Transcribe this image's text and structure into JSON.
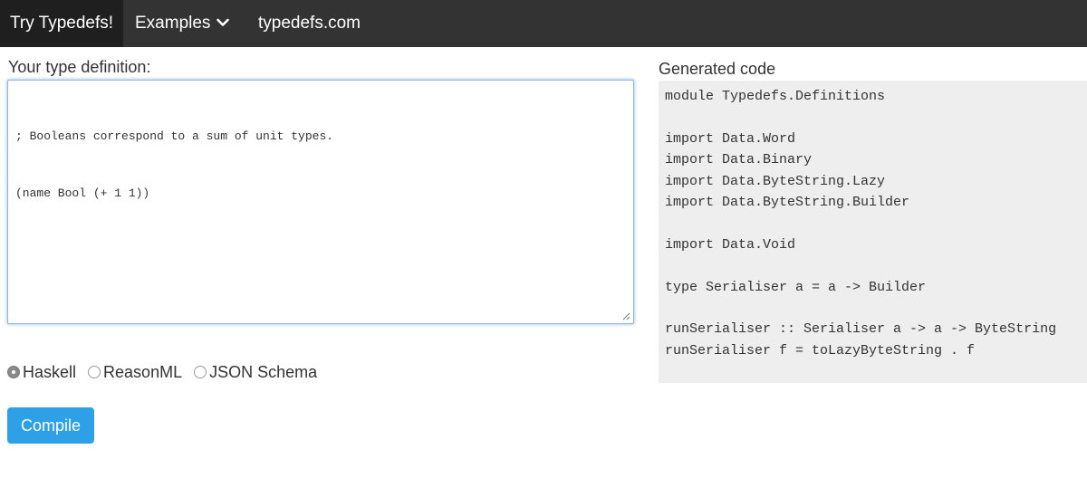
{
  "navbar": {
    "brand": "Try Typedefs!",
    "examples_label": "Examples",
    "site_link": "typedefs.com"
  },
  "editor": {
    "label": "Your type definition:",
    "lines": [
      "; Booleans correspond to a sum of unit types.",
      "(name Bool (+ 1 1))"
    ]
  },
  "targets": {
    "options": [
      "Haskell",
      "ReasonML",
      "JSON Schema"
    ],
    "selected": "Haskell"
  },
  "compile_label": "Compile",
  "output": {
    "label": "Generated code",
    "lines": [
      "module Typedefs.Definitions",
      "",
      "import Data.Word",
      "import Data.Binary",
      "import Data.ByteString.Lazy",
      "import Data.ByteString.Builder",
      "",
      "import Data.Void",
      "",
      "type Serialiser a = a -> Builder",
      "",
      "runSerialiser :: Serialiser a -> a -> ByteString",
      "runSerialiser f = toLazyByteString . f"
    ]
  },
  "colors": {
    "navbar": "#333333",
    "brand_bg": "#1f1f1f",
    "button": "#2ea0e8",
    "code_bg": "#eeeeee"
  },
  "icons": {
    "examples_dropdown": "chevron-down-icon",
    "editor_resize": "resize-grip-icon"
  }
}
